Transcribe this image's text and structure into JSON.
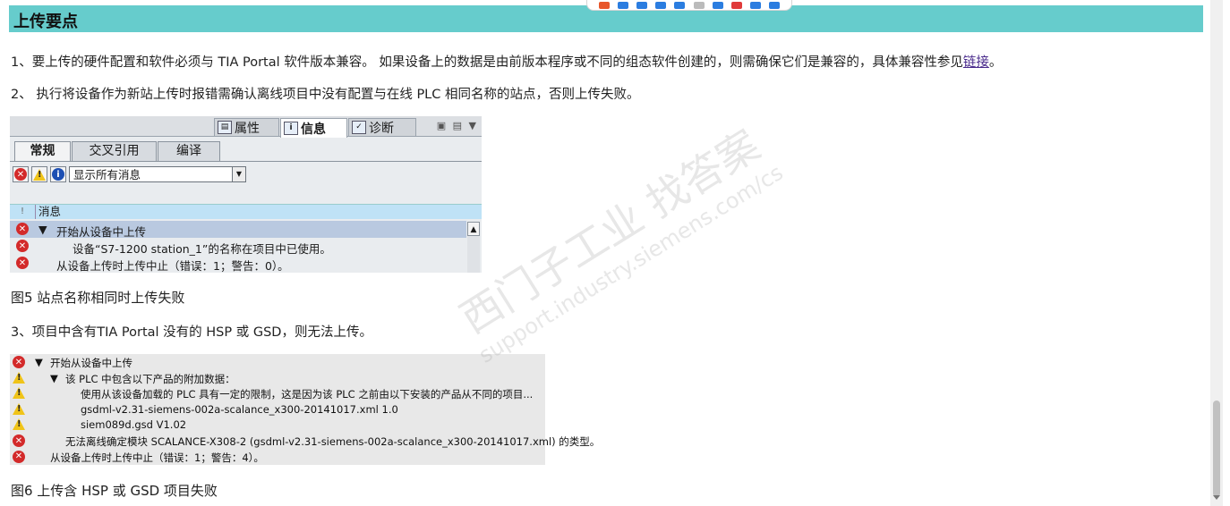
{
  "header": {
    "title": "上传要点",
    "bg_color": "#66cccc"
  },
  "paragraphs": {
    "p1_text": "1、要上传的硬件配置和软件必须与 TIA Portal 软件版本兼容。 如果设备上的数据是由前版本程序或不同的组态软件创建的，则需确保它们是兼容的，具体兼容性参见",
    "p1_link": "链接",
    "p1_end": "。",
    "p2": "2、 执行将设备作为新站上传时报错需确认离线项目中没有配置与在线 PLC 相同名称的站点，否则上传失败。",
    "p3": "3、项目中含有TIA Portal 没有的 HSP 或 GSD，则无法上传。"
  },
  "figure5": {
    "top_tabs": [
      {
        "label": "属性",
        "icon": "properties-icon"
      },
      {
        "label": "信息",
        "icon": "info-tab-icon"
      },
      {
        "label": "诊断",
        "icon": "diagnostics-icon"
      }
    ],
    "sub_tabs": [
      "常规",
      "交叉引用",
      "编译"
    ],
    "filter_value": "显示所有消息",
    "column_header": "消息",
    "column_bang": "!",
    "rows": [
      {
        "icon": "error-icon",
        "expand": "▼",
        "text": "开始从设备中上传"
      },
      {
        "icon": "error-icon",
        "expand": "",
        "text": "设备“S7-1200 station_1”的名称在项目中已使用。"
      },
      {
        "icon": "error-icon",
        "expand": "",
        "text": "从设备上传时上传中止（错误：1；警告：0）。"
      }
    ],
    "caption": "图5 站点名称相同时上传失败"
  },
  "figure6": {
    "rows": [
      {
        "icon": "error",
        "expand": "▼",
        "text": "开始从设备中上传"
      },
      {
        "icon": "warning",
        "expand": "▼",
        "text": "该 PLC 中包含以下产品的附加数据："
      },
      {
        "icon": "warning",
        "expand": "",
        "text": "使用从该设备加载的 PLC 具有一定的限制，这是因为该 PLC 之前由以下安装的产品从不同的项目..."
      },
      {
        "icon": "warning",
        "expand": "",
        "text": "gsdml-v2.31-siemens-002a-scalance_x300-20141017.xml 1.0"
      },
      {
        "icon": "warning",
        "expand": "",
        "text": "siem089d.gsd V1.02"
      },
      {
        "icon": "error",
        "expand": "",
        "text": "无法离线确定模块 SCALANCE-X308-2 (gsdml-v2.31-siemens-002a-scalance_x300-20141017.xml) 的类型。"
      },
      {
        "icon": "error",
        "expand": "",
        "text": "从设备上传时上传中止（错误：1；警告：4）。"
      }
    ],
    "caption": "图6 上传含 HSP 或 GSD 项目失败"
  },
  "watermark": {
    "line1": "西门子工业 找答案",
    "line2": "support.industry.siemens.com/cs"
  }
}
